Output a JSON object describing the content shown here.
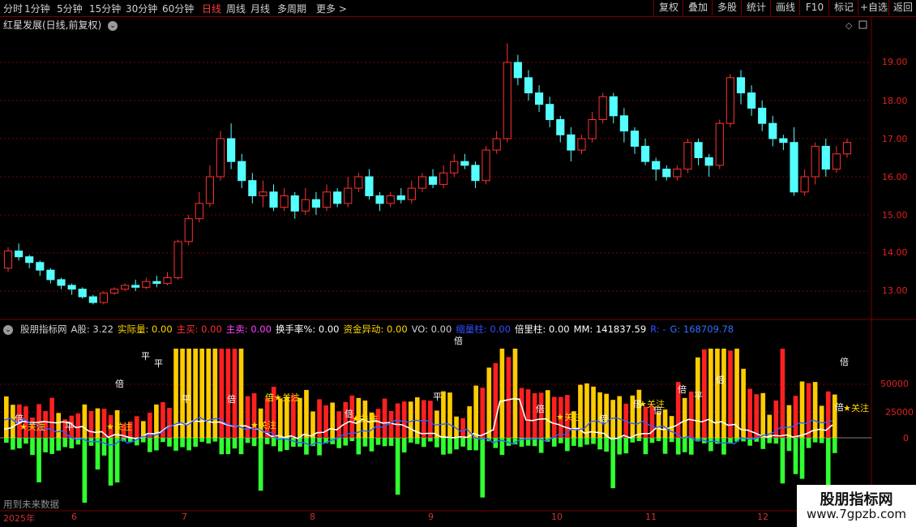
{
  "toolbar": {
    "periods": [
      "分时",
      "1分钟",
      "5分钟",
      "15分钟",
      "30分钟",
      "60分钟",
      "日线",
      "周线",
      "月线",
      "多周期",
      "更多 >"
    ],
    "active_period": "日线",
    "right_buttons": [
      "复权",
      "叠加",
      "多股",
      "统计",
      "画线",
      "F10",
      "标记",
      "+自选",
      "返回"
    ]
  },
  "stock": {
    "title": "红星发展(日线,前复权)",
    "chevron": "chevron-down-icon"
  },
  "price_axis": [
    "19.00",
    "18.00",
    "17.00",
    "16.00",
    "15.00",
    "14.00",
    "13.00"
  ],
  "volume_axis": [
    "50000",
    "25000",
    "0"
  ],
  "indicator": {
    "legend": [
      {
        "text": "股朋指标网",
        "color": "#d0d0d0"
      },
      {
        "text": "A股: 3.22",
        "color": "#d0d0d0"
      },
      {
        "text": "实际量: 0.00",
        "color": "#ffd700"
      },
      {
        "text": "主买: 0.00",
        "color": "#ff3030"
      },
      {
        "text": "主卖: 0.00",
        "color": "#ff40ff"
      },
      {
        "text": "换手率%: 0.00",
        "color": "#ffffff"
      },
      {
        "text": "资金异动: 0.00",
        "color": "#ffd700"
      },
      {
        "text": "VO: 0.00",
        "color": "#d0d0d0"
      },
      {
        "text": "缩量柱: 0.00",
        "color": "#3050ff"
      },
      {
        "text": "倍里柱: 0.00",
        "color": "#ffffff"
      },
      {
        "text": "MM: 141837.59",
        "color": "#ffffff"
      },
      {
        "text": "R: -",
        "color": "#3050ff"
      },
      {
        "text": "G: 168709.78",
        "color": "#3070ff"
      }
    ]
  },
  "markers": {
    "bei": "倍",
    "ping": "平",
    "guanzhu": "关注",
    "star": "★"
  },
  "x_axis": [
    "2025年",
    "6",
    "7",
    "8",
    "9",
    "10",
    "11",
    "12"
  ],
  "footer": {
    "future_data": "用到未来数据"
  },
  "watermark": {
    "name": "股朋指标网",
    "url": "www.7gpzb.com"
  },
  "colors": {
    "up": "#ff3030",
    "down": "#54ffff",
    "vol_up_red": "#ff2020",
    "vol_yellow": "#ffcc00",
    "vol_green": "#30ff30",
    "grid": "#7a0000"
  },
  "chart_data": {
    "type": "candlestick",
    "title": "红星发展(日线,前复权)",
    "ylim": [
      12.7,
      19.6
    ],
    "candles": [
      [
        13.6,
        14.05,
        14.15,
        13.5
      ],
      [
        14.05,
        13.9,
        14.25,
        13.8
      ],
      [
        13.9,
        13.75,
        13.95,
        13.6
      ],
      [
        13.75,
        13.55,
        13.8,
        13.4
      ],
      [
        13.55,
        13.3,
        13.6,
        13.2
      ],
      [
        13.3,
        13.15,
        13.35,
        13.05
      ],
      [
        13.15,
        13.05,
        13.2,
        12.9
      ],
      [
        13.05,
        12.85,
        13.1,
        12.8
      ],
      [
        12.85,
        12.7,
        12.9,
        12.65
      ],
      [
        12.7,
        12.95,
        13.0,
        12.65
      ],
      [
        12.95,
        13.05,
        13.1,
        12.9
      ],
      [
        13.05,
        13.15,
        13.2,
        13.0
      ],
      [
        13.15,
        13.1,
        13.3,
        13.0
      ],
      [
        13.1,
        13.25,
        13.35,
        13.05
      ],
      [
        13.25,
        13.2,
        13.4,
        13.1
      ],
      [
        13.2,
        13.35,
        13.5,
        13.15
      ],
      [
        13.35,
        14.3,
        14.35,
        13.3
      ],
      [
        14.3,
        14.9,
        15.0,
        14.2
      ],
      [
        14.9,
        15.3,
        15.6,
        14.8
      ],
      [
        15.3,
        16.0,
        16.3,
        15.2
      ],
      [
        16.0,
        17.0,
        17.2,
        15.9
      ],
      [
        17.0,
        16.4,
        17.4,
        16.2
      ],
      [
        16.4,
        15.9,
        16.6,
        15.7
      ],
      [
        15.9,
        15.5,
        16.1,
        15.3
      ],
      [
        15.5,
        15.6,
        15.9,
        15.2
      ],
      [
        15.6,
        15.2,
        15.8,
        15.1
      ],
      [
        15.2,
        15.5,
        15.7,
        15.1
      ],
      [
        15.5,
        15.1,
        15.6,
        14.9
      ],
      [
        15.1,
        15.4,
        15.7,
        15.0
      ],
      [
        15.4,
        15.2,
        15.6,
        15.0
      ],
      [
        15.2,
        15.6,
        15.8,
        15.1
      ],
      [
        15.6,
        15.3,
        15.7,
        15.2
      ],
      [
        15.3,
        15.7,
        16.0,
        15.2
      ],
      [
        15.7,
        16.0,
        16.1,
        15.6
      ],
      [
        16.0,
        15.5,
        16.2,
        15.4
      ],
      [
        15.5,
        15.3,
        15.6,
        15.1
      ],
      [
        15.3,
        15.5,
        15.6,
        15.2
      ],
      [
        15.5,
        15.4,
        15.7,
        15.3
      ],
      [
        15.4,
        15.7,
        15.9,
        15.3
      ],
      [
        15.7,
        16.0,
        16.1,
        15.6
      ],
      [
        16.0,
        15.8,
        16.2,
        15.7
      ],
      [
        15.8,
        16.1,
        16.3,
        15.7
      ],
      [
        16.1,
        16.4,
        16.6,
        16.0
      ],
      [
        16.4,
        16.3,
        16.6,
        16.2
      ],
      [
        16.3,
        15.9,
        16.4,
        15.7
      ],
      [
        15.9,
        16.7,
        16.8,
        15.8
      ],
      [
        16.7,
        17.0,
        17.2,
        16.6
      ],
      [
        17.0,
        19.0,
        19.5,
        16.9
      ],
      [
        19.0,
        18.6,
        19.2,
        18.4
      ],
      [
        18.6,
        18.2,
        18.8,
        18.0
      ],
      [
        18.2,
        17.9,
        18.4,
        17.7
      ],
      [
        17.9,
        17.5,
        18.1,
        17.3
      ],
      [
        17.5,
        17.1,
        17.6,
        16.9
      ],
      [
        17.1,
        16.7,
        17.3,
        16.4
      ],
      [
        16.7,
        17.0,
        17.1,
        16.6
      ],
      [
        17.0,
        17.5,
        17.7,
        16.9
      ],
      [
        17.5,
        18.1,
        18.2,
        17.4
      ],
      [
        18.1,
        17.6,
        18.2,
        17.4
      ],
      [
        17.6,
        17.2,
        17.8,
        16.9
      ],
      [
        17.2,
        16.8,
        17.3,
        16.6
      ],
      [
        16.8,
        16.4,
        17.0,
        16.3
      ],
      [
        16.4,
        16.2,
        16.5,
        15.9
      ],
      [
        16.2,
        16.0,
        16.3,
        15.9
      ],
      [
        16.0,
        16.2,
        16.3,
        15.9
      ],
      [
        16.2,
        16.9,
        17.0,
        16.1
      ],
      [
        16.9,
        16.5,
        17.0,
        16.3
      ],
      [
        16.5,
        16.3,
        16.6,
        16.0
      ],
      [
        16.3,
        17.4,
        17.5,
        16.2
      ],
      [
        17.4,
        18.6,
        18.7,
        17.3
      ],
      [
        18.6,
        18.2,
        18.8,
        17.9
      ],
      [
        18.2,
        17.8,
        18.4,
        17.6
      ],
      [
        17.8,
        17.4,
        18.0,
        17.2
      ],
      [
        17.4,
        17.0,
        17.6,
        16.8
      ],
      [
        17.0,
        16.9,
        17.1,
        16.7
      ],
      [
        16.9,
        15.6,
        17.3,
        15.5
      ],
      [
        15.6,
        16.0,
        16.2,
        15.5
      ],
      [
        16.0,
        16.8,
        16.9,
        15.8
      ],
      [
        16.8,
        16.2,
        17.0,
        16.0
      ],
      [
        16.2,
        16.6,
        16.8,
        16.1
      ],
      [
        16.6,
        16.9,
        17.0,
        16.5
      ]
    ],
    "volume_bars": "computed per candle (estimated)"
  }
}
